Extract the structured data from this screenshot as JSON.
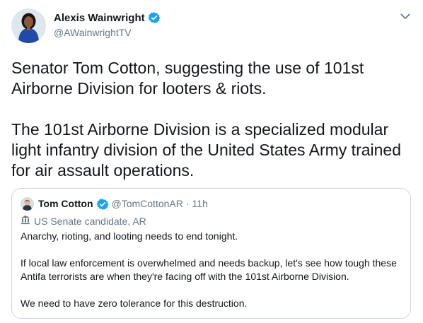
{
  "tweet": {
    "author": {
      "name": "Alexis Wainwright",
      "handle": "@AWainwrightTV"
    },
    "text": [
      "Senator Tom Cotton, suggesting the use of 101st Airborne Division for looters & riots.",
      "The 101st Airborne Division is a specialized modular light infantry division of the United States Army trained for air assault operations."
    ],
    "quoted": {
      "name": "Tom Cotton",
      "handle": "@TomCottonAR",
      "separator": "·",
      "time": "11h",
      "label": "US Senate candidate, AR",
      "text": [
        "Anarchy, rioting, and looting needs to end tonight.",
        "If local law enforcement is overwhelmed and needs backup, let's see how tough these Antifa terrorists are when they're facing off with the 101st Airborne Division.",
        "We need to have zero tolerance for this destruction."
      ]
    }
  },
  "icons": {
    "verified": "verified-badge-icon",
    "caret": "chevron-down-icon",
    "government": "government-building-icon"
  },
  "colors": {
    "verified_blue": "#1da1f2",
    "text_primary": "#14171a",
    "text_secondary": "#657786",
    "border": "#ccd6dd"
  }
}
